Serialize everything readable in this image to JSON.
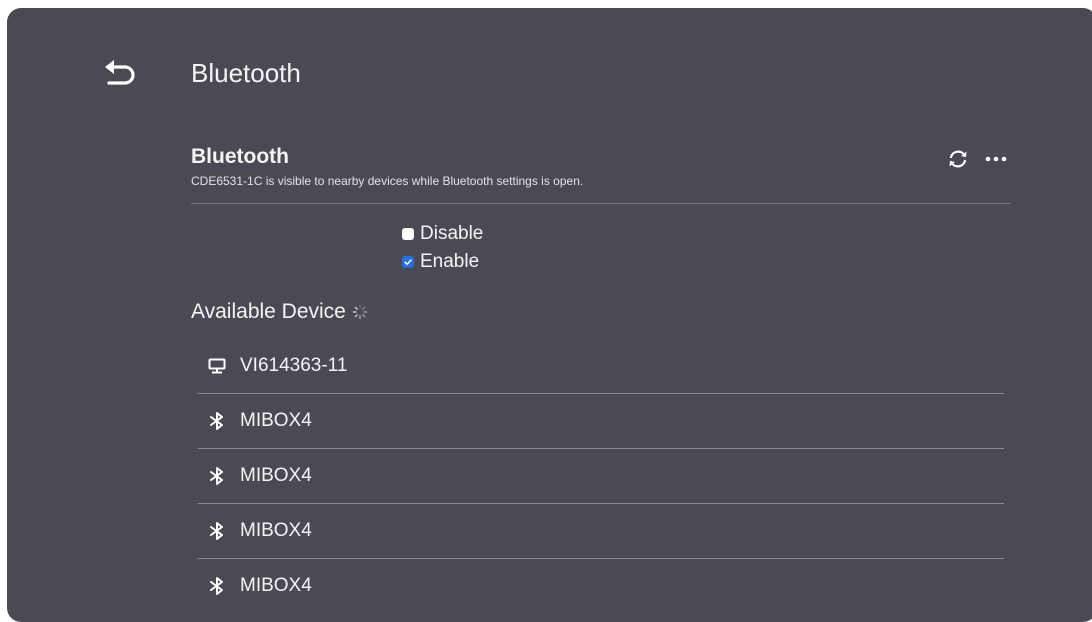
{
  "header": {
    "title": "Bluetooth",
    "back_icon": "back-arrow-icon"
  },
  "bluetooth": {
    "title": "Bluetooth",
    "description": "CDE6531-1C is visible to nearby devices while Bluetooth settings is open.",
    "refresh_icon": "refresh-icon",
    "more_icon": "more-options-icon"
  },
  "toggle": {
    "options": [
      {
        "label": "Disable",
        "checked": false
      },
      {
        "label": "Enable",
        "checked": true
      }
    ],
    "accent": "#2a6ed8"
  },
  "available": {
    "title": "Available Device",
    "loading_icon": "loading-spinner-icon",
    "devices": [
      {
        "name": "VI614363-11",
        "icon": "monitor-icon"
      },
      {
        "name": "MIBOX4",
        "icon": "bluetooth-icon"
      },
      {
        "name": "MIBOX4",
        "icon": "bluetooth-icon"
      },
      {
        "name": "MIBOX4",
        "icon": "bluetooth-icon"
      },
      {
        "name": "MIBOX4",
        "icon": "bluetooth-icon"
      }
    ]
  },
  "colors": {
    "panel_bg": "#4a4a54",
    "text": "#f4f4f4",
    "divider": "#8a8a92"
  }
}
